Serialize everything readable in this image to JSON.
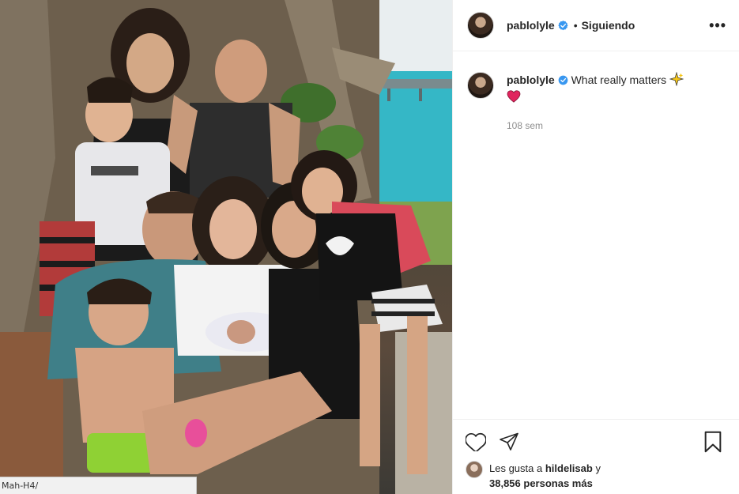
{
  "post": {
    "username": "pablolyle",
    "follow_label": "Siguiendo",
    "dot": "•",
    "more_label": "•••",
    "caption_text": "What really matters",
    "time_ago": "108 sem",
    "likes_prefix": "Les gusta a",
    "liked_by": "hildelisab",
    "likes_mid": "y",
    "likes_count": "38,856 personas más"
  },
  "icons": {
    "verified": "verified-badge-icon",
    "like": "heart-icon",
    "share": "paper-plane-icon",
    "save": "bookmark-icon",
    "options": "more-options-icon"
  },
  "browser": {
    "status_url": "Mah-H4/"
  },
  "colors": {
    "verified_blue": "#3897f0",
    "heart_red": "#e0245e",
    "text": "#262626",
    "muted": "#8e8e8e"
  }
}
